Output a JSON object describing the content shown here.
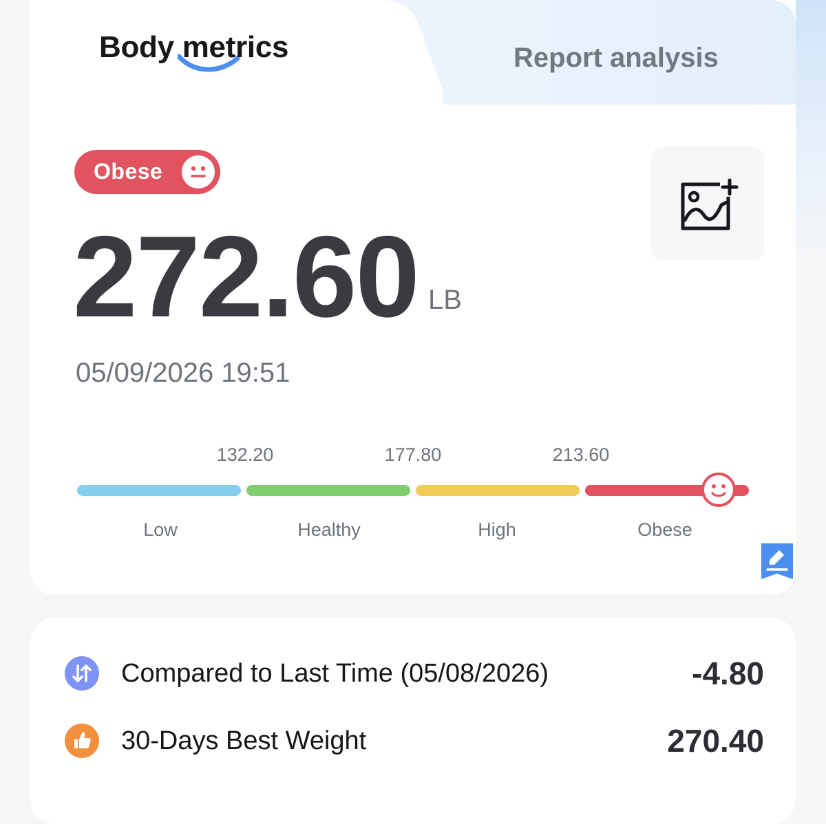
{
  "tabs": {
    "active_label": "Body metrics",
    "inactive_label": "Report analysis"
  },
  "status": {
    "label": "Obese",
    "color": "#e0535f",
    "icon": "smiley-face-icon"
  },
  "weight": {
    "value": "272.60",
    "unit": "LB"
  },
  "timestamp": "05/09/2026 19:51",
  "photo_button": {
    "icon": "add-image-icon"
  },
  "scale": {
    "thresholds": [
      "132.20",
      "177.80",
      "213.60"
    ],
    "segments": [
      {
        "label": "Low",
        "color": "#84cfee"
      },
      {
        "label": "Healthy",
        "color": "#7fce6e"
      },
      {
        "label": "High",
        "color": "#efcb58"
      },
      {
        "label": "Obese",
        "color": "#e0535f"
      }
    ],
    "current_segment": "Obese"
  },
  "edit_button": {
    "icon": "edit-pencil-icon",
    "color": "#4a8ff0"
  },
  "stats": [
    {
      "icon": "up-down-arrows-icon",
      "icon_color": "#7f93f5",
      "label": "Compared to Last Time (05/08/2026)",
      "value": "-4.80"
    },
    {
      "icon": "thumbs-up-icon",
      "icon_color": "#f2903f",
      "label": "30-Days Best Weight",
      "value": "270.40"
    }
  ]
}
